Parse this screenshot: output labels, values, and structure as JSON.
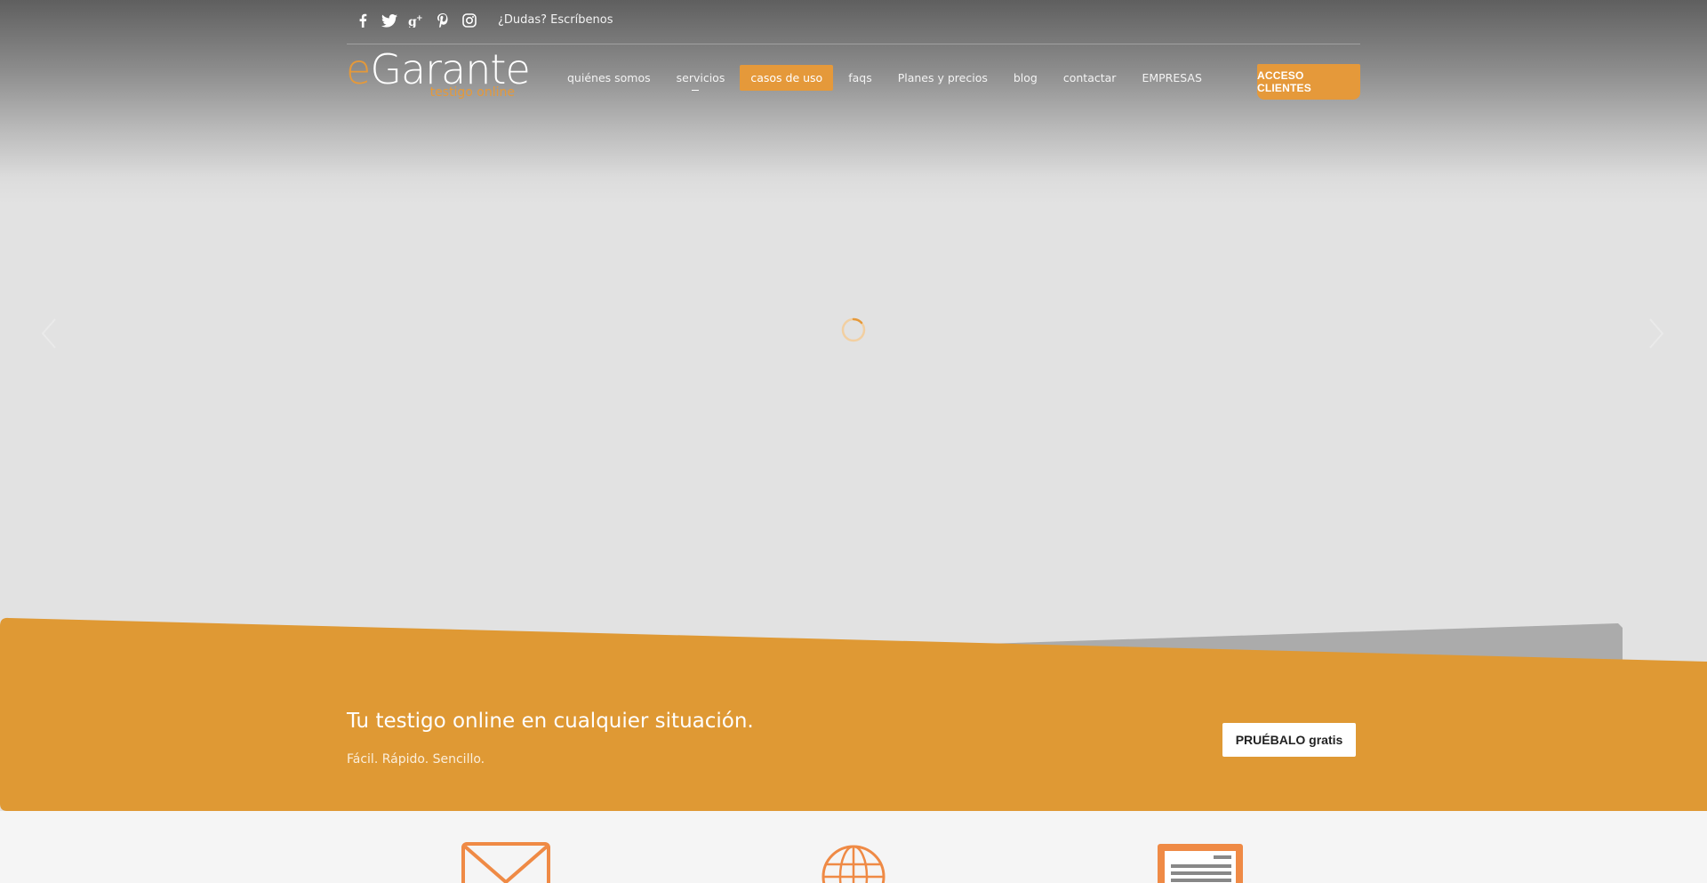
{
  "topbar": {
    "socials": [
      {
        "icon": "facebook-icon",
        "glyph": "f"
      },
      {
        "icon": "twitter-icon",
        "glyph": "t"
      },
      {
        "icon": "google-plus-icon",
        "glyph": "g+"
      },
      {
        "icon": "pinterest-icon",
        "glyph": "p"
      },
      {
        "icon": "instagram-icon",
        "glyph": "ig"
      }
    ],
    "dudas": "¿Dudas? Escríbenos"
  },
  "logo": {
    "prefix": "e",
    "rest": "Garante",
    "tagline": "testigo online"
  },
  "nav": {
    "items": [
      {
        "label": "quiénes somos"
      },
      {
        "label": "servicios"
      },
      {
        "label": "casos de uso"
      },
      {
        "label": "faqs"
      },
      {
        "label": "Planes y precios"
      },
      {
        "label": "blog"
      },
      {
        "label": "contactar"
      },
      {
        "label": "EMPRESAS"
      }
    ],
    "active": "casos de uso",
    "cta": "ACCESO CLIENTES"
  },
  "banner": {
    "title": "Tu testigo online en cualquier situación.",
    "subtitle": "Fácil. Rápido. Sencillo.",
    "button": "PRUÉBALO gratis"
  },
  "features": [
    {
      "icon": "envelope-icon"
    },
    {
      "icon": "globe-icon"
    },
    {
      "icon": "document-icon"
    }
  ],
  "colors": {
    "accent": "#e5993a",
    "banner": "#df9934",
    "hero_bg": "#e2e2e2",
    "icon_orange": "#ef8a45"
  }
}
